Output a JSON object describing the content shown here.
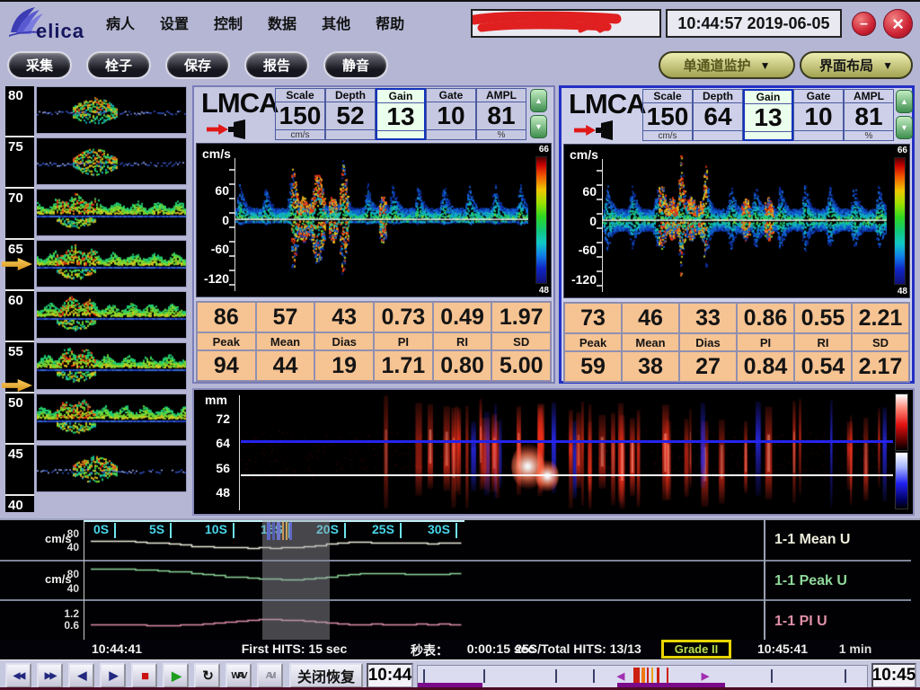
{
  "window": {
    "logo": "elica",
    "time": "10:44:57 2019-06-05",
    "minimize": "–",
    "close": "×"
  },
  "menu": {
    "items": [
      "病人",
      "设置",
      "控制",
      "数据",
      "其他",
      "帮助"
    ]
  },
  "toolbar": {
    "buttons": [
      "采集",
      "栓子",
      "保存",
      "报告",
      "静音"
    ],
    "dropdowns": [
      {
        "label": "单通道监护",
        "arrow": "▼"
      },
      {
        "label": "界面布局",
        "arrow": "▼"
      }
    ]
  },
  "depth_scale": {
    "labels": [
      "80",
      "75",
      "70",
      "65",
      "60",
      "55",
      "50",
      "45",
      "40"
    ],
    "panels": [
      "sparse",
      "sparse",
      "dense",
      "dense",
      "dense",
      "dense",
      "dense",
      "sparse"
    ]
  },
  "channels": [
    {
      "name": "LMCA",
      "params": [
        {
          "label": "Scale",
          "value": "150",
          "unit": "cm/s",
          "bg": "",
          "border": ""
        },
        {
          "label": "Depth",
          "value": "52",
          "unit": "",
          "bg": "",
          "border": ""
        },
        {
          "label": "Gain",
          "value": "13",
          "unit": "",
          "bg": "#eaffec",
          "border": "2px solid #1133bb"
        },
        {
          "label": "Gate",
          "value": "10",
          "unit": "",
          "bg": "",
          "border": ""
        },
        {
          "label": "AMPL",
          "value": "81",
          "unit": "%",
          "bg": "",
          "border": ""
        }
      ],
      "spectrum": {
        "unit": "cm/s",
        "ticks": [
          "60",
          "0",
          "-60",
          "-120"
        ],
        "cb_top": "66",
        "cb_bottom": "48"
      },
      "table": {
        "row1": [
          "86",
          "57",
          "43",
          "0.73",
          "0.49",
          "1.97"
        ],
        "headers": [
          "Peak",
          "Mean",
          "Dias",
          "PI",
          "RI",
          "SD"
        ],
        "row2": [
          "94",
          "44",
          "19",
          "1.71",
          "0.80",
          "5.00"
        ]
      }
    },
    {
      "name": "LMCA",
      "params": [
        {
          "label": "Scale",
          "value": "150",
          "unit": "cm/s",
          "bg": "",
          "border": ""
        },
        {
          "label": "Depth",
          "value": "64",
          "unit": "",
          "bg": "",
          "border": ""
        },
        {
          "label": "Gain",
          "value": "13",
          "unit": "",
          "bg": "#eaffec",
          "border": "2px solid #1133bb"
        },
        {
          "label": "Gate",
          "value": "10",
          "unit": "",
          "bg": "",
          "border": ""
        },
        {
          "label": "AMPL",
          "value": "81",
          "unit": "%",
          "bg": "",
          "border": ""
        }
      ],
      "spectrum": {
        "unit": "cm/s",
        "ticks": [
          "60",
          "0",
          "-60",
          "-120"
        ],
        "cb_top": "66",
        "cb_bottom": "48"
      },
      "table": {
        "row1": [
          "73",
          "46",
          "33",
          "0.86",
          "0.55",
          "2.21"
        ],
        "headers": [
          "Peak",
          "Mean",
          "Dias",
          "PI",
          "RI",
          "SD"
        ],
        "row2": [
          "59",
          "38",
          "27",
          "0.84",
          "0.54",
          "2.17"
        ]
      }
    }
  ],
  "mmode": {
    "unit": "mm",
    "ticks": [
      "72",
      "64",
      "56",
      "48"
    ]
  },
  "trend": {
    "time_labels": [
      "0S",
      "5S",
      "10S",
      "15S",
      "20S",
      "25S",
      "30S"
    ],
    "rows": [
      {
        "unit": "cm/s",
        "tick_top": "80",
        "tick_bottom": "40",
        "label": "1-1 Mean U",
        "color": "#eeeedd"
      },
      {
        "unit": "cm/s",
        "tick_top": "80",
        "tick_bottom": "40",
        "label": "1-1 Peak U",
        "color": "#8fd89a"
      },
      {
        "unit": "",
        "tick_top": "1.2",
        "tick_bottom": "0.6",
        "label": "1-1 PI U",
        "color": "#e090a8"
      }
    ],
    "series": [
      {
        "name": "Mean",
        "values": [
          66,
          67,
          66,
          65,
          63,
          61,
          59,
          56,
          53,
          50,
          48,
          47,
          46,
          45,
          44,
          45,
          44,
          45,
          46,
          48,
          52,
          56,
          60,
          62,
          62,
          61,
          60,
          60,
          59,
          59,
          58,
          59,
          60,
          61
        ]
      },
      {
        "name": "Peak",
        "values": [
          93,
          94,
          94,
          93,
          92,
          91,
          90,
          88,
          86,
          83,
          80,
          77,
          74,
          72,
          70,
          69,
          68,
          67,
          67,
          68,
          70,
          74,
          78,
          81,
          82,
          83,
          83,
          82,
          81,
          80,
          80,
          81,
          82,
          82
        ]
      },
      {
        "name": "PI",
        "values": [
          0.72,
          0.71,
          0.72,
          0.7,
          0.69,
          0.68,
          0.67,
          0.68,
          0.7,
          0.72,
          0.75,
          0.8,
          0.88,
          0.95,
          1.0,
          1.02,
          1.03,
          1.0,
          0.97,
          0.92,
          0.88,
          0.8,
          0.74,
          0.72,
          0.73,
          0.74,
          0.73,
          0.72,
          0.73,
          0.74,
          0.73,
          0.74,
          0.72,
          0.7
        ]
      }
    ]
  },
  "status": {
    "time_start": "10:44:41",
    "first_hits": "First HITS: 15 sec",
    "stopwatch_label": "秒表：",
    "stopwatch_value": "0:00:15 sec",
    "total_hits": "25S/Total HITS: 13/13",
    "grade": "Grade II",
    "time_end": "10:45:41",
    "duration": "1 min"
  },
  "transport": {
    "buttons": [
      {
        "name": "rewind-button",
        "glyph": "◀◀",
        "color": "#22287e",
        "fs": "10px"
      },
      {
        "name": "fast-forward-button",
        "glyph": "▶▶",
        "color": "#22287e",
        "fs": "10px"
      },
      {
        "name": "step-back-button",
        "glyph": "◀",
        "color": "#22287e",
        "fs": "13px"
      },
      {
        "name": "step-forward-button",
        "glyph": "▶",
        "color": "#22287e",
        "fs": "13px"
      },
      {
        "name": "stop-button",
        "glyph": "■",
        "color": "#cc1111",
        "fs": "15px"
      },
      {
        "name": "play-button",
        "glyph": "▶",
        "color": "#1d9e1d",
        "fs": "14px"
      },
      {
        "name": "loop-button",
        "glyph": "↻",
        "color": "#111111",
        "fs": "15px"
      },
      {
        "name": "wav-button",
        "glyph": "WAV",
        "color": "#111111",
        "fs": "10px"
      },
      {
        "name": "avi-button",
        "glyph": "AVI",
        "color": "#8a8a98",
        "fs": "10px"
      }
    ],
    "close_restore": "关闭恢复",
    "time_left": "10:44",
    "time_right": "10:45"
  }
}
